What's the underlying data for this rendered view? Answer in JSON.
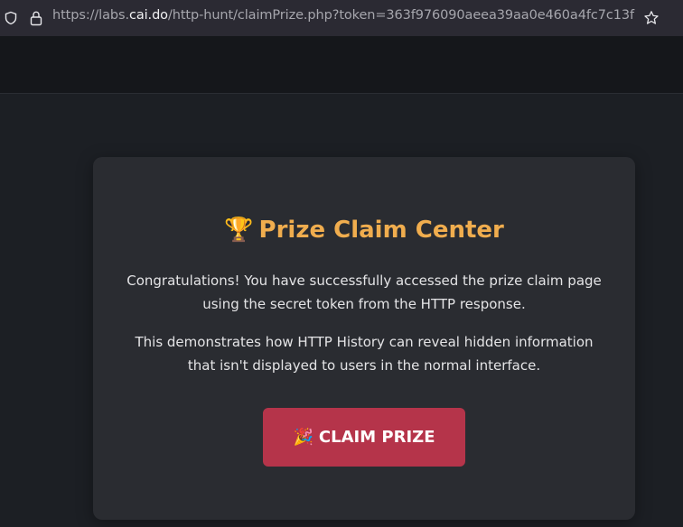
{
  "browser": {
    "url_prefix": "https://labs.",
    "url_host": "cai.do",
    "url_path": "/http-hunt/claimPrize.php?token=363f976090aeea39aa0e460a4fc7c13f",
    "icons": [
      "shield-icon",
      "lock-icon",
      "star-icon"
    ]
  },
  "card": {
    "trophy_emoji": "🏆",
    "title": "Prize Claim Center",
    "paragraph1": "Congratulations! You have successfully accessed the prize claim page using the secret token from the HTTP response.",
    "paragraph2": "This demonstrates how HTTP History can reveal hidden information that isn't displayed to users in the normal interface.",
    "button_emoji": "🎉",
    "button_label": "CLAIM PRIZE"
  },
  "colors": {
    "accent_title": "#f0ad4e",
    "button": "#b5344a",
    "card_bg": "#2a2c31",
    "page_bg": "#1c1f24"
  }
}
